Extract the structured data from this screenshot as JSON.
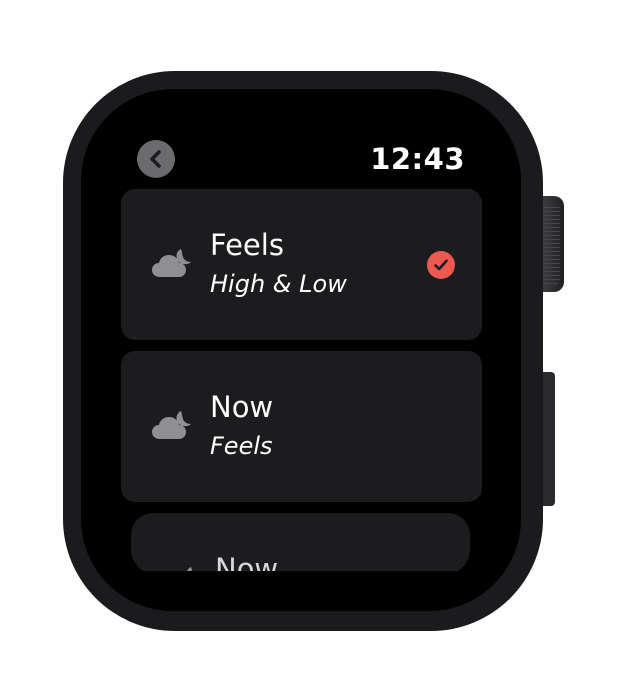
{
  "status": {
    "time": "12:43"
  },
  "options": [
    {
      "title": "Feels",
      "subtitle": "High & Low",
      "icon": "cloud-moon-icon",
      "selected": true
    },
    {
      "title": "Now",
      "subtitle": "Feels",
      "icon": "cloud-moon-icon",
      "selected": false
    },
    {
      "title": "Now",
      "icon": "cloud-moon-icon",
      "selected": false
    }
  ],
  "colors": {
    "accent": "#ec5a4f",
    "card": "#1c1c1e",
    "screen": "#000000"
  }
}
